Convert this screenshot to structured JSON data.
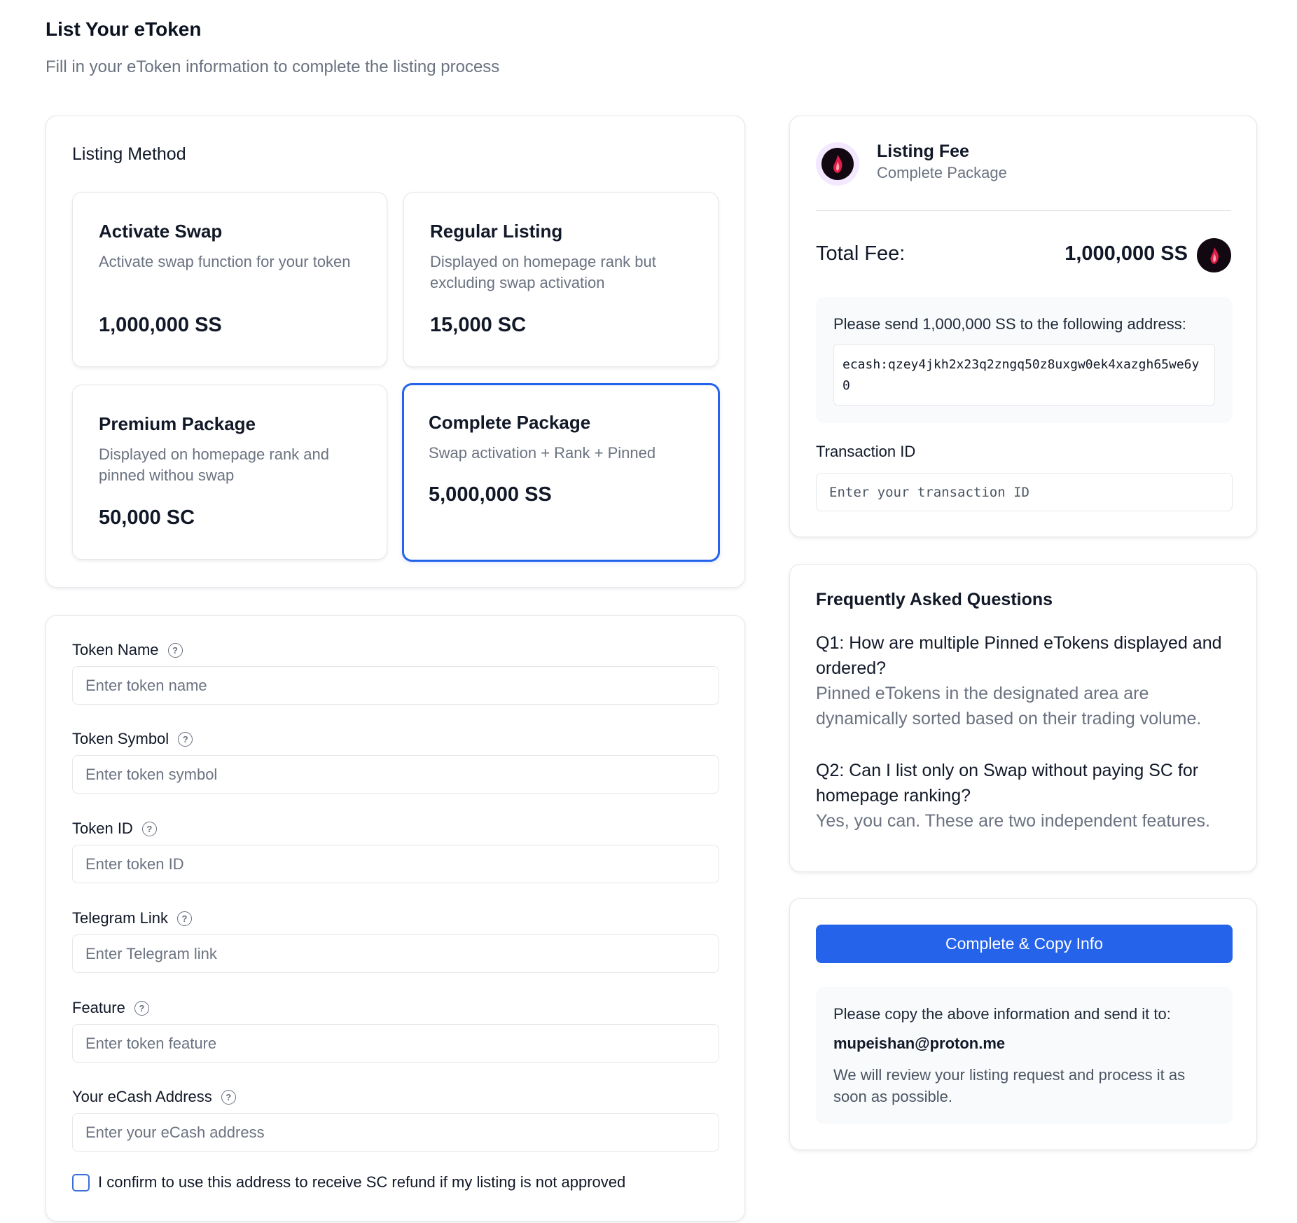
{
  "header": {
    "title": "List Your eToken",
    "subtitle": "Fill in your eToken information to complete the listing process"
  },
  "listing_method": {
    "title": "Listing Method",
    "selected": "Complete Package",
    "options": [
      {
        "name": "Activate Swap",
        "description": "Activate swap function for your token",
        "price": "1,000,000 SS"
      },
      {
        "name": "Regular Listing",
        "description": "Displayed on homepage rank but excluding swap activation",
        "price": "15,000 SC"
      },
      {
        "name": "Premium Package",
        "description": "Displayed on homepage rank and pinned withou swap",
        "price": "50,000 SC"
      },
      {
        "name": "Complete Package",
        "description": "Swap activation + Rank + Pinned",
        "price": "5,000,000 SS"
      }
    ]
  },
  "form": {
    "fields": [
      {
        "label": "Token Name",
        "placeholder": "Enter token name",
        "value": ""
      },
      {
        "label": "Token Symbol",
        "placeholder": "Enter token symbol",
        "value": ""
      },
      {
        "label": "Token ID",
        "placeholder": "Enter token ID",
        "value": ""
      },
      {
        "label": "Telegram Link",
        "placeholder": "Enter Telegram link",
        "value": ""
      },
      {
        "label": "Feature",
        "placeholder": "Enter token feature",
        "value": ""
      },
      {
        "label": "Your eCash Address",
        "placeholder": "Enter your eCash address",
        "value": ""
      }
    ],
    "confirm_label": "I confirm to use this address to receive SC refund if my listing is not approved",
    "confirm_checked": false
  },
  "fee": {
    "title": "Listing Fee",
    "package": "Complete Package",
    "total_label": "Total Fee:",
    "total_amount": "1,000,000 SS",
    "send_instruction": "Please send 1,000,000 SS to the following address:",
    "address": "ecash:qzey4jkh2x23q2zngq50z8uxgw0ek4xazgh65we6y0",
    "txid_label": "Transaction ID",
    "txid_placeholder": "Enter your transaction ID",
    "txid_value": ""
  },
  "faq": {
    "title": "Frequently Asked Questions",
    "items": [
      {
        "q": "Q1: How are multiple Pinned eTokens displayed and ordered?",
        "a": "Pinned eTokens in the designated area are dynamically sorted based on their trading volume."
      },
      {
        "q": "Q2: Can I list only on Swap without paying SC for homepage ranking?",
        "a": "Yes, you can. These are two independent features."
      }
    ]
  },
  "action": {
    "button_label": "Complete & Copy Info",
    "info_text": "Please copy the above information and send it to:",
    "email": "mupeishan@proton.me",
    "note": "We will review your listing request and process it as soon as possible."
  },
  "colors": {
    "accent": "#2563eb",
    "muted_text": "#6b7280",
    "border": "#e5e7eb",
    "panel_bg": "#f8fafc",
    "token_logo_bg": "#120812",
    "token_logo_flame": "#e11d48"
  },
  "icons": {
    "help": "question-circle-icon",
    "token_logo": "flame-token-icon"
  }
}
